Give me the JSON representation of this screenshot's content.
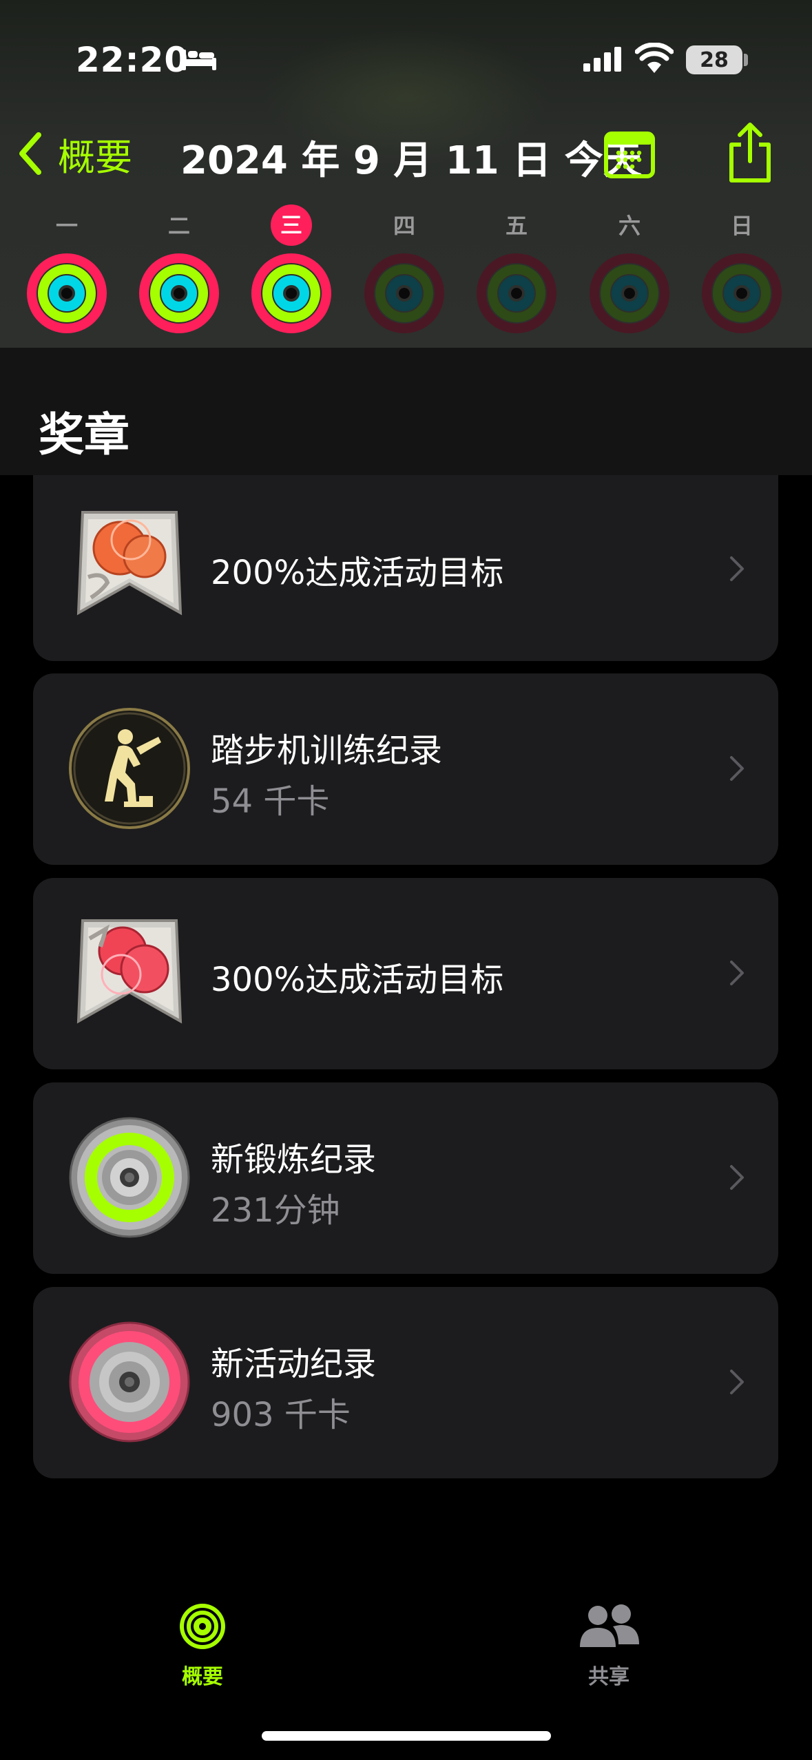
{
  "status_bar": {
    "time": "22:20",
    "battery": "28"
  },
  "nav": {
    "back_label": "概要",
    "title": "2024 年 9 月 11 日 今天"
  },
  "week": {
    "days": [
      {
        "label": "一",
        "state": "done"
      },
      {
        "label": "二",
        "state": "done"
      },
      {
        "label": "三",
        "state": "current"
      },
      {
        "label": "四",
        "state": "future"
      },
      {
        "label": "五",
        "state": "future"
      },
      {
        "label": "六",
        "state": "future"
      },
      {
        "label": "日",
        "state": "future"
      }
    ]
  },
  "section": {
    "title": "奖章"
  },
  "awards": [
    {
      "title": "200%达成活动目标",
      "subtitle": "",
      "icon": "badge-200-percent-icon"
    },
    {
      "title": "踏步机训练纪录",
      "subtitle": "54 千卡",
      "icon": "stair-stepper-medal-icon"
    },
    {
      "title": "300%达成活动目标",
      "subtitle": "",
      "icon": "badge-300-percent-icon"
    },
    {
      "title": "新锻炼纪录",
      "subtitle": "231分钟",
      "icon": "exercise-record-medal-icon"
    },
    {
      "title": "新活动纪录",
      "subtitle": "903 千卡",
      "icon": "move-record-medal-icon"
    }
  ],
  "tabs": [
    {
      "label": "概要",
      "icon": "activity-rings-icon",
      "active": true
    },
    {
      "label": "共享",
      "icon": "people-icon",
      "active": false
    }
  ],
  "colors": {
    "accent": "#a6ff00",
    "move": "#ff1f5a",
    "exercise": "#a6ff00",
    "stand": "#00d7e6",
    "card": "#1c1c1e"
  }
}
